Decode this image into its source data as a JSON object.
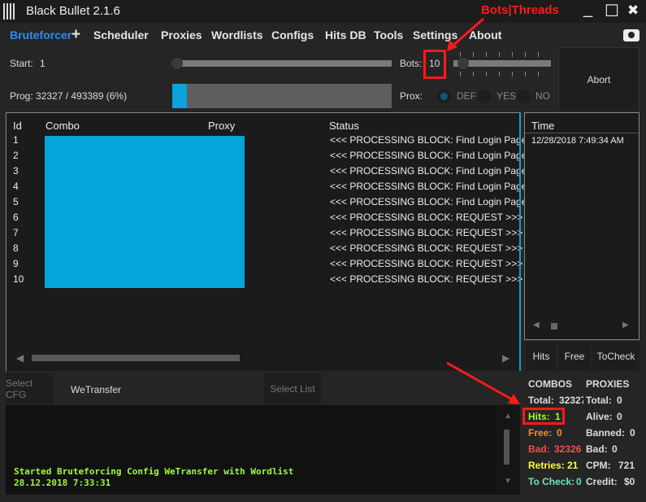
{
  "window": {
    "title": "Black Bullet 2.1.6",
    "minimize": "_",
    "maximize": "☐",
    "close": "✖"
  },
  "menu": {
    "items": [
      "Bruteforcer",
      "Scheduler",
      "Proxies",
      "Wordlists",
      "Configs",
      "Hits DB",
      "Tools",
      "Settings",
      "About"
    ],
    "add": "+",
    "active_color": "#2a8df5"
  },
  "controls": {
    "start_label": "Start:",
    "start_value": "1",
    "bots_label": "Bots:",
    "bots_value": "10",
    "prog_label": "Prog: 32327 / 493389 (6%)",
    "progress_fraction": 0.0655,
    "prox_label": "Prox:",
    "prox_options": [
      "DEF",
      "YES",
      "NO"
    ],
    "prox_selected": "DEF",
    "abort": "Abort",
    "accent": "#0aa3dc"
  },
  "table": {
    "headers": [
      "Id",
      "Combo",
      "Proxy",
      "Status"
    ],
    "rows": [
      {
        "id": "1",
        "status": "<<< PROCESSING BLOCK: Find Login Page"
      },
      {
        "id": "2",
        "status": "<<< PROCESSING BLOCK: Find Login Page"
      },
      {
        "id": "3",
        "status": "<<< PROCESSING BLOCK: Find Login Page"
      },
      {
        "id": "4",
        "status": "<<< PROCESSING BLOCK: Find Login Page"
      },
      {
        "id": "5",
        "status": "<<< PROCESSING BLOCK: Find Login Page"
      },
      {
        "id": "6",
        "status": "<<< PROCESSING BLOCK: REQUEST >>>"
      },
      {
        "id": "7",
        "status": "<<< PROCESSING BLOCK: REQUEST >>>"
      },
      {
        "id": "8",
        "status": "<<< PROCESSING BLOCK: REQUEST >>>"
      },
      {
        "id": "9",
        "status": "<<< PROCESSING BLOCK: REQUEST >>>"
      },
      {
        "id": "10",
        "status": "<<< PROCESSING BLOCK: REQUEST >>>"
      }
    ]
  },
  "time_panel": {
    "header": "Time",
    "entry": "12/28/2018 7:49:34 AM",
    "buttons": [
      "Hits",
      "Free",
      "ToCheck"
    ]
  },
  "config": {
    "select_cfg": "Select CFG",
    "cfg_value": "WeTransfer",
    "select_list": "Select List"
  },
  "log": [
    "Started Bruteforcing Config WeTransfer with Wordlist",
    "28.12.2018 7:33:31"
  ],
  "stats": {
    "combos_header": "COMBOS",
    "proxies_header": "PROXIES",
    "combos": [
      {
        "label": "Total:",
        "value": "32327",
        "color": "#dddddd"
      },
      {
        "label": "Hits:",
        "value": "1",
        "color": "#9efb34"
      },
      {
        "label": "Free:",
        "value": "0",
        "color": "#ff8c1a"
      },
      {
        "label": "Bad:",
        "value": "32326",
        "color": "#f0504a"
      },
      {
        "label": "Retries:",
        "value": "21",
        "color": "#ffff33"
      },
      {
        "label": "To Check:",
        "value": "0",
        "color": "#6ee8b0"
      }
    ],
    "proxies": [
      {
        "label": "Total:",
        "value": "0"
      },
      {
        "label": "Alive:",
        "value": "0"
      },
      {
        "label": "Banned:",
        "value": "0"
      },
      {
        "label": "Bad:",
        "value": "0"
      },
      {
        "label": "CPM:",
        "value": "721"
      },
      {
        "label": "Credit:",
        "value": "$0"
      }
    ]
  },
  "annotation": {
    "text": "Bots|Threads",
    "color": "#ff1a1a"
  }
}
